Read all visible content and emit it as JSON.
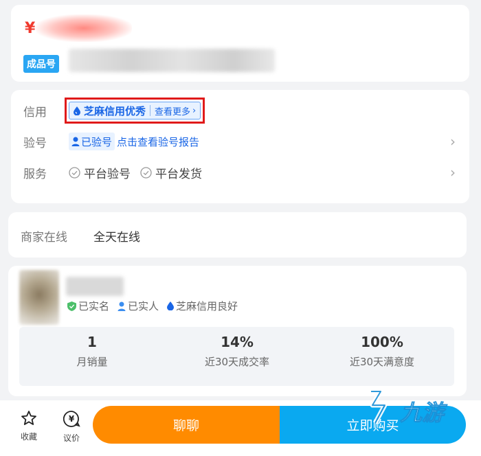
{
  "price": {
    "currency_symbol": "¥"
  },
  "product": {
    "tag_label": "成品号"
  },
  "info": {
    "credit": {
      "label": "信用",
      "badge_text": "芝麻信用优秀",
      "more_text": "查看更多"
    },
    "verify": {
      "label": "验号",
      "status": "已验号",
      "report_link": "点击查看验号报告"
    },
    "service": {
      "label": "服务",
      "items": [
        "平台验号",
        "平台发货"
      ]
    }
  },
  "online": {
    "label": "商家在线",
    "value": "全天在线"
  },
  "seller": {
    "badges": [
      "已实名",
      "已实人",
      "芝麻信用良好"
    ],
    "stats": [
      {
        "value": "1",
        "label": "月销量"
      },
      {
        "value": "14%",
        "label": "近30天成交率"
      },
      {
        "value": "100%",
        "label": "近30天满意度"
      }
    ]
  },
  "bottom_bar": {
    "favorite_label": "收藏",
    "bargain_label": "议价",
    "chat_label": "聊聊",
    "buy_label": "立即购买"
  },
  "watermark": {
    "text": "九游"
  },
  "colors": {
    "accent_blue": "#1a66e6",
    "orange": "#ff8b00",
    "cyan": "#0aa9f0",
    "price_red": "#f03a2e",
    "highlight_red": "#e01a1a"
  }
}
